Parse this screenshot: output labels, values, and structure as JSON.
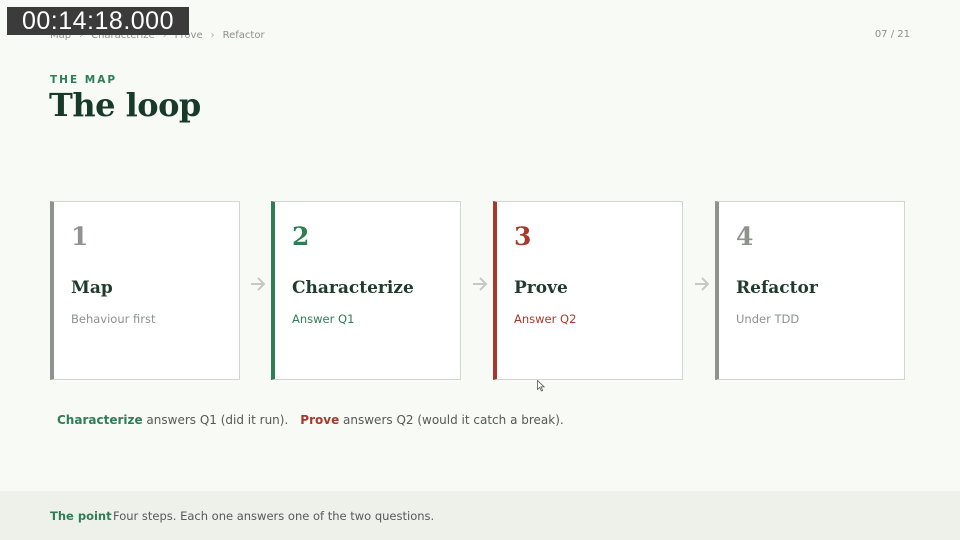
{
  "timestamp": "00:14:18.000",
  "breadcrumb": [
    "Map",
    "Characterize",
    "Prove",
    "Refactor"
  ],
  "breadcrumb_separator": "›",
  "page_counter": "07 / 21",
  "eyebrow": "THE MAP",
  "title": "The loop",
  "steps": [
    {
      "number": "1",
      "title": "Map",
      "subtitle": "Behaviour first"
    },
    {
      "number": "2",
      "title": "Characterize",
      "subtitle": "Answer Q1"
    },
    {
      "number": "3",
      "title": "Prove",
      "subtitle": "Answer Q2"
    },
    {
      "number": "4",
      "title": "Refactor",
      "subtitle": "Under TDD"
    }
  ],
  "step_arrow_icon": "arrow-right-icon",
  "note": {
    "term1": "Characterize",
    "text1": " answers Q1 (did it run).",
    "term2": "Prove",
    "text2": " answers Q2 (would it catch a break)."
  },
  "footer": {
    "label": "The point",
    "text": "Four steps. Each one answers one of the two questions."
  },
  "colors": {
    "accent_green": "#2e7d55",
    "accent_red": "#a53a2c",
    "muted_gray": "#8e938e",
    "background": "#f7faf5"
  }
}
